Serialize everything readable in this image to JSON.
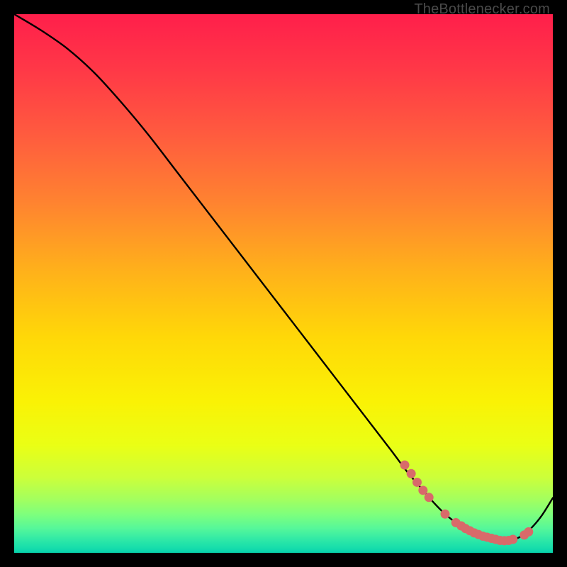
{
  "attribution": "TheBottlenecker.com",
  "chart_data": {
    "type": "line",
    "title": "",
    "xlabel": "",
    "ylabel": "",
    "xlim": [
      0,
      100
    ],
    "ylim": [
      0,
      100
    ],
    "grid": false,
    "legend": false,
    "gradient_stops": [
      {
        "offset": 0.0,
        "color": "#ff1f4b"
      },
      {
        "offset": 0.1,
        "color": "#ff3747"
      },
      {
        "offset": 0.22,
        "color": "#ff5a3f"
      },
      {
        "offset": 0.35,
        "color": "#ff8330"
      },
      {
        "offset": 0.48,
        "color": "#ffb21a"
      },
      {
        "offset": 0.6,
        "color": "#ffd808"
      },
      {
        "offset": 0.72,
        "color": "#faf205"
      },
      {
        "offset": 0.8,
        "color": "#eaff15"
      },
      {
        "offset": 0.86,
        "color": "#ccff3a"
      },
      {
        "offset": 0.9,
        "color": "#a4ff5e"
      },
      {
        "offset": 0.93,
        "color": "#7cff7e"
      },
      {
        "offset": 0.955,
        "color": "#55f79a"
      },
      {
        "offset": 0.975,
        "color": "#30e9a6"
      },
      {
        "offset": 0.99,
        "color": "#18deab"
      },
      {
        "offset": 1.0,
        "color": "#07d3ac"
      }
    ],
    "series": [
      {
        "name": "bottleneck-curve",
        "color": "#000000",
        "x": [
          0,
          5,
          10,
          15,
          20,
          25,
          30,
          35,
          40,
          45,
          50,
          55,
          60,
          65,
          70,
          73,
          76,
          78,
          80,
          82,
          84,
          86,
          88,
          90,
          92,
          94,
          96,
          98,
          100
        ],
        "y": [
          100,
          97,
          93.5,
          89,
          83.5,
          77.5,
          71,
          64.5,
          58,
          51.5,
          45,
          38.5,
          32,
          25.5,
          19,
          15,
          11.5,
          9.2,
          7.2,
          5.6,
          4.3,
          3.3,
          2.6,
          2.2,
          2.3,
          3.0,
          4.6,
          7.0,
          10.2
        ]
      }
    ],
    "markers": {
      "name": "highlight-dots",
      "color": "#d86a6a",
      "radius": 6.5,
      "points": [
        {
          "x": 72.5,
          "y": 16.3
        },
        {
          "x": 73.7,
          "y": 14.7
        },
        {
          "x": 74.8,
          "y": 13.1
        },
        {
          "x": 75.9,
          "y": 11.6
        },
        {
          "x": 77.0,
          "y": 10.3
        },
        {
          "x": 80.0,
          "y": 7.2
        },
        {
          "x": 82.0,
          "y": 5.6
        },
        {
          "x": 83.0,
          "y": 5.0
        },
        {
          "x": 83.8,
          "y": 4.5
        },
        {
          "x": 84.6,
          "y": 4.1
        },
        {
          "x": 85.4,
          "y": 3.7
        },
        {
          "x": 86.2,
          "y": 3.4
        },
        {
          "x": 87.0,
          "y": 3.1
        },
        {
          "x": 87.8,
          "y": 2.9
        },
        {
          "x": 88.6,
          "y": 2.7
        },
        {
          "x": 89.4,
          "y": 2.5
        },
        {
          "x": 90.2,
          "y": 2.3
        },
        {
          "x": 91.0,
          "y": 2.25
        },
        {
          "x": 91.8,
          "y": 2.3
        },
        {
          "x": 92.6,
          "y": 2.5
        },
        {
          "x": 94.7,
          "y": 3.3
        },
        {
          "x": 95.5,
          "y": 3.9
        }
      ]
    }
  }
}
